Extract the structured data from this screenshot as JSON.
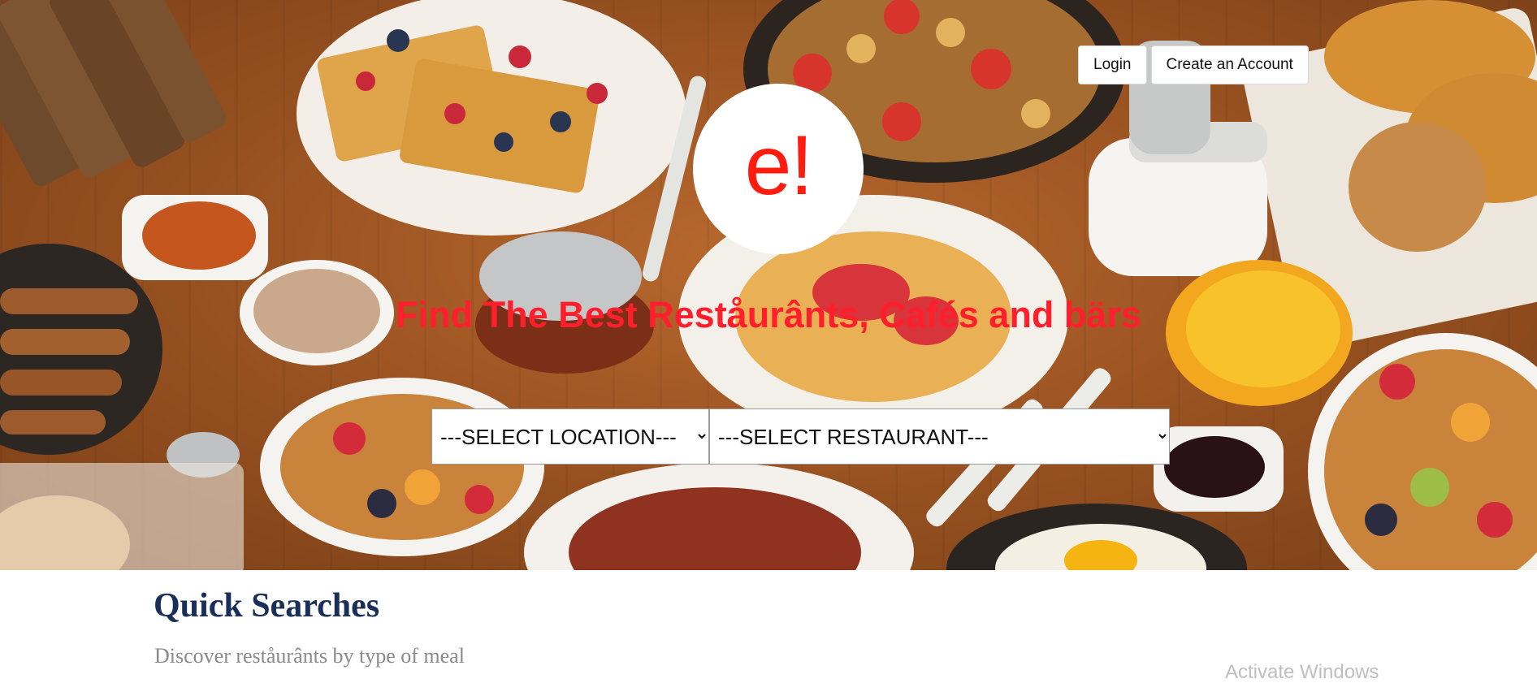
{
  "header": {
    "login_label": "Login",
    "create_account_label": "Create an Account"
  },
  "logo": {
    "text": "e!",
    "color": "#ff1c0f"
  },
  "hero": {
    "headline": "Find The Best Reståurânts, Cafés and bärs",
    "headline_color": "#ff1f2c",
    "background_icon": "breakfast-table-photo"
  },
  "search": {
    "location_selected": "---SELECT LOCATION---",
    "restaurant_selected": "---SELECT RESTAURANT---"
  },
  "quick_searches": {
    "title": "Quick Searches",
    "subtitle": "Discover reståurânts by type of meal",
    "title_color": "#192f59"
  },
  "system": {
    "watermark": "Activate Windows"
  }
}
